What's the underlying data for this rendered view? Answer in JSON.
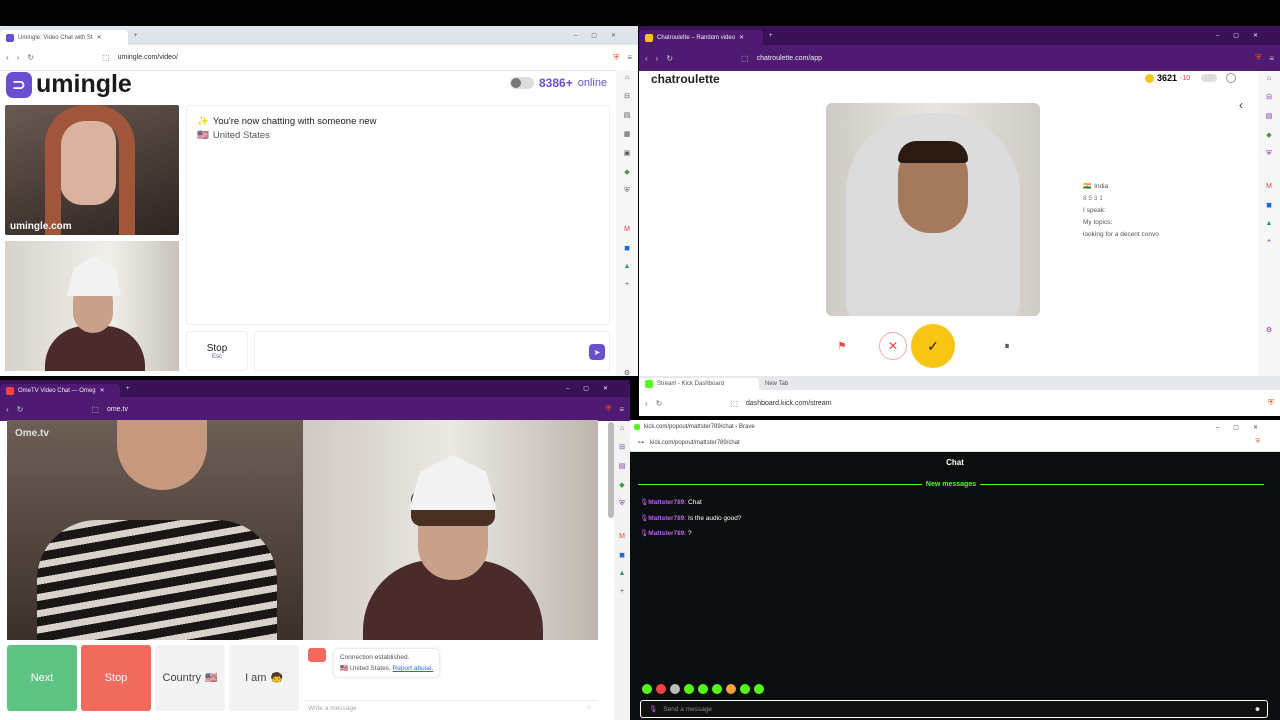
{
  "umingle": {
    "tab_title": "Umingle: Video Chat with St",
    "url": "umingle.com/video/",
    "logo": "umingle",
    "online_count": "8386+",
    "online_label": "online",
    "status_line": "You're now chatting with someone new",
    "status_emoji": "✨",
    "country": "United States",
    "watermark": "umingle.com",
    "stop_label": "Stop",
    "stop_hint": "Esc"
  },
  "chatroulette": {
    "tab_title": "Chatroulette – Random video",
    "url": "chatroulette.com/app",
    "logo": "chatroulette",
    "coins": "3621",
    "coins_delta": "-10",
    "country": "India",
    "stats": "8  5  3  1",
    "speak_label": "I speak:",
    "topics_label": "My topics:",
    "bio": "looking for a decent convo"
  },
  "kick_dashboard": {
    "tab1": "Stream - Kick Dashboard",
    "tab2": "New Tab",
    "url": "dashboard.kick.com/stream"
  },
  "kick_chat": {
    "window_title": "kick.com/popout/mattster789/chat - Brave",
    "url": "kick.com/popout/mattster789/chat",
    "header": "Chat",
    "new_messages": "New messages",
    "messages": [
      {
        "user": "Mattster789",
        "text": "Chat"
      },
      {
        "user": "Mattster789",
        "text": "Is the audio good?"
      },
      {
        "user": "Mattster789",
        "text": "?"
      }
    ],
    "input_placeholder": "Send a message"
  },
  "ometv": {
    "tab_title": "OmeTV Video Chat — Omeg",
    "url": "ome.tv",
    "logo": "Ome.tv",
    "next_label": "Next",
    "stop_label": "Stop",
    "country_label": "Country",
    "iam_label": "I am",
    "conn_status": "Connection established.",
    "conn_country": "United States.",
    "report_label": "Report abuse.",
    "message_placeholder": "Write a message"
  },
  "colors": {
    "umingle_brand": "#6b4fcf",
    "chatroulette_yellow": "#f7c615",
    "ometv_green": "#5fc483",
    "ometv_red": "#f06b5e",
    "kick_green": "#53fc18",
    "kick_username": "#c35ef5"
  }
}
